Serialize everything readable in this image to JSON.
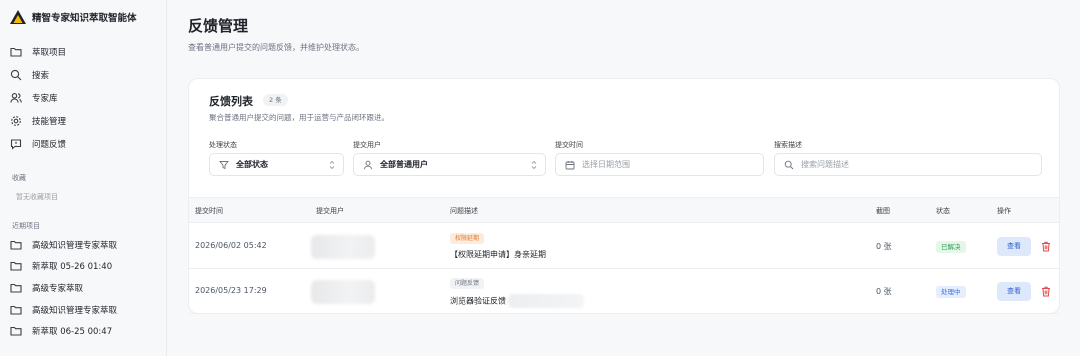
{
  "brand": {
    "title": "精智专家知识萃取智能体"
  },
  "nav": [
    {
      "label": "萃取项目",
      "icon": "folder-icon"
    },
    {
      "label": "搜索",
      "icon": "search-icon"
    },
    {
      "label": "专家库",
      "icon": "users-icon"
    },
    {
      "label": "技能管理",
      "icon": "gear-icon"
    },
    {
      "label": "问题反馈",
      "icon": "feedback-icon"
    }
  ],
  "favorites": {
    "title": "收藏",
    "empty": "暂无收藏项目"
  },
  "recent": {
    "title": "近期项目",
    "items": [
      {
        "label": "高级知识管理专家萃取"
      },
      {
        "label": "新萃取 05-26 01:40"
      },
      {
        "label": "高级专家萃取"
      },
      {
        "label": "高级知识管理专家萃取"
      },
      {
        "label": "新萃取 06-25 00:47"
      }
    ]
  },
  "page": {
    "title": "反馈管理",
    "subtitle": "查看普通用户提交的问题反馈，并维护处理状态。"
  },
  "card": {
    "title": "反馈列表",
    "count": "2 条",
    "subtitle": "聚合普通用户提交的问题，用于运营与产品闭环跟进。"
  },
  "filters": {
    "status": {
      "label": "处理状态",
      "value": "全部状态"
    },
    "user": {
      "label": "提交用户",
      "value": "全部普通用户"
    },
    "time": {
      "label": "提交时间",
      "placeholder": "选择日期范围"
    },
    "search": {
      "label": "搜索描述",
      "placeholder": "搜索问题描述"
    }
  },
  "table": {
    "columns": {
      "time": "提交时间",
      "user": "提交用户",
      "desc": "问题描述",
      "shots": "截图",
      "status": "状态",
      "action": "操作"
    },
    "rows": [
      {
        "time": "2026/06/02 05:42",
        "tag": "权限延期",
        "desc": "【权限延期申请】身亲延期",
        "shots": "0 张",
        "status": "已解决",
        "action": "查看"
      },
      {
        "time": "2026/05/23 17:29",
        "tag": "问题反馈",
        "desc": "浏览器验证反馈",
        "shots": "0 张",
        "status": "处理中",
        "action": "查看"
      }
    ]
  },
  "colors": {
    "accent": "#2f5fd0",
    "danger": "#e5484d",
    "success": "#2e9a4f",
    "warning": "#e2792b"
  }
}
